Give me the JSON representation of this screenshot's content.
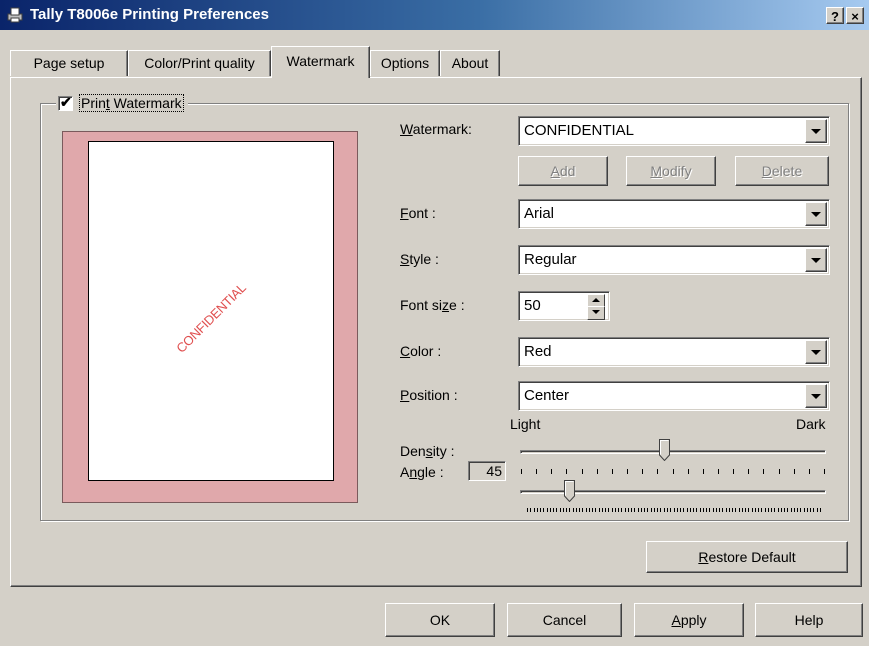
{
  "window": {
    "title": "Tally T8006e Printing Preferences",
    "help_button": "?",
    "close_button": "×"
  },
  "tabs": [
    {
      "label": "Page setup",
      "active": false
    },
    {
      "label": "Color/Print quality",
      "active": false
    },
    {
      "label": "Watermark",
      "active": true
    },
    {
      "label": "Options",
      "active": false
    },
    {
      "label": "About",
      "active": false
    }
  ],
  "watermark_panel": {
    "print_watermark": {
      "label_before": "Prin",
      "label_mnemonic": "t",
      "label_after": " Watermark",
      "checked": true,
      "check_glyph": "✔"
    },
    "preview": {
      "text": "CONFIDENTIAL",
      "color": "#e05050"
    },
    "watermark": {
      "label_mnemonic": "W",
      "label_rest": "atermark:",
      "value": "CONFIDENTIAL"
    },
    "buttons": {
      "add": {
        "mnemonic": "A",
        "rest": "dd"
      },
      "modify": {
        "mnemonic": "M",
        "rest": "odify"
      },
      "delete": {
        "mnemonic": "D",
        "rest": "elete"
      }
    },
    "font": {
      "label_mnemonic": "F",
      "label_rest": "ont :",
      "value": "Arial"
    },
    "style": {
      "label_mnemonic": "S",
      "label_rest": "tyle :",
      "value": "Regular"
    },
    "font_size": {
      "label_before": "Font si",
      "label_mnemonic": "z",
      "label_after": "e :",
      "value": "50"
    },
    "color": {
      "label_mnemonic": "C",
      "label_rest": "olor :",
      "value": "Red"
    },
    "position": {
      "label_mnemonic": "P",
      "label_rest": "osition :",
      "value": "Center"
    },
    "density": {
      "label_before": "Den",
      "label_mnemonic": "s",
      "label_after": "ity :",
      "light_label": "Light",
      "dark_label": "Dark",
      "level": 0.47
    },
    "angle": {
      "label_before": "A",
      "label_mnemonic": "n",
      "label_after": "gle :",
      "value": "45",
      "level": 0.15
    },
    "restore_default": {
      "mnemonic": "R",
      "rest": "estore Default"
    }
  },
  "footer": {
    "ok": "OK",
    "cancel": "Cancel",
    "apply": {
      "mnemonic": "A",
      "rest": "pply"
    },
    "help": "Help"
  },
  "colors": {
    "preview_border": "#e0a8ab",
    "title_bar": "#0a246a",
    "preview_text": "#e05050"
  }
}
